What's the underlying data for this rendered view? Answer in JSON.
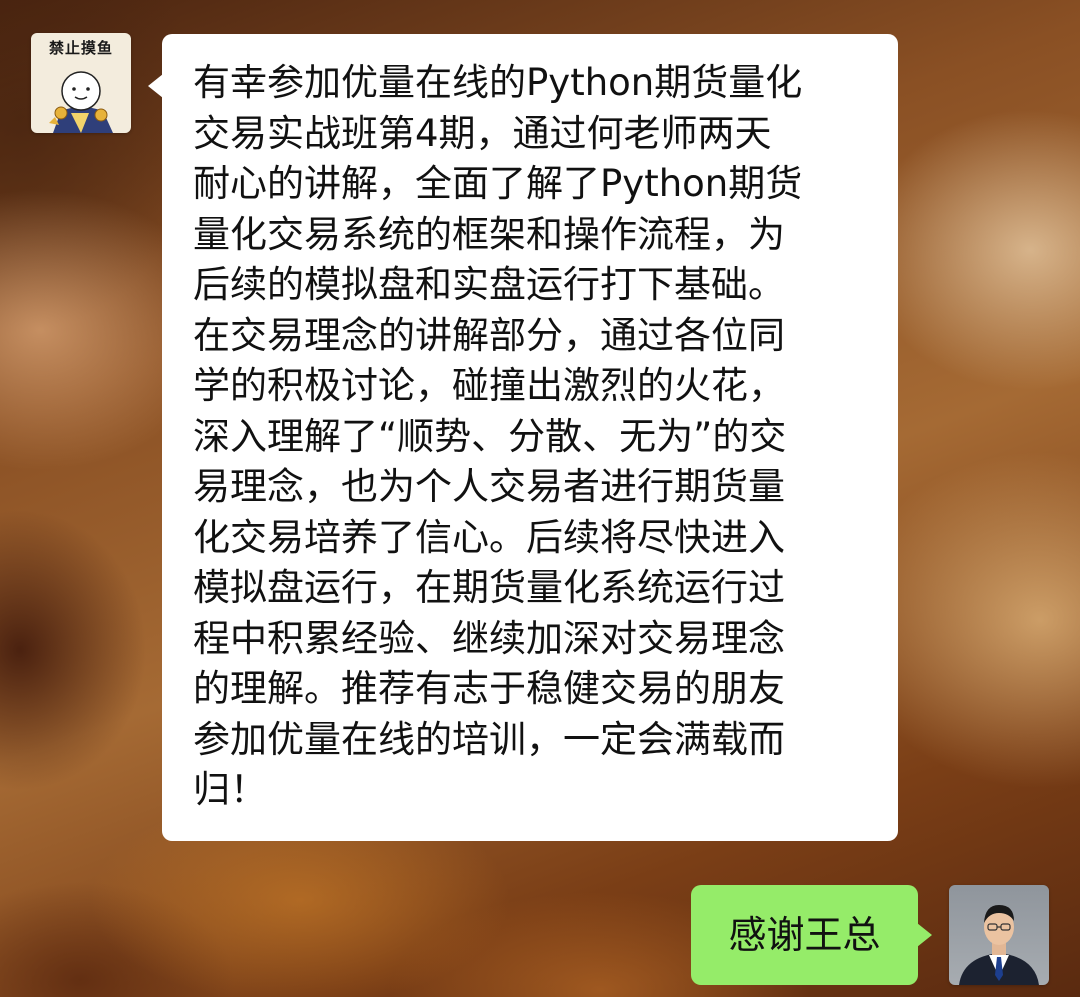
{
  "chat": {
    "messages": [
      {
        "sender": "contact",
        "avatar_caption": "禁止摸鱼",
        "text": "有幸参加优量在线的Python期货量化\n交易实战班第4期，通过何老师两天\n耐心的讲解，全面了解了Python期货\n量化交易系统的框架和操作流程，为\n后续的模拟盘和实盘运行打下基础。\n在交易理念的讲解部分，通过各位同\n学的积极讨论，碰撞出激烈的火花，\n深入理解了“顺势、分散、无为”的交\n易理念，也为个人交易者进行期货量\n化交易培养了信心。后续将尽快进入\n模拟盘运行，在期货量化系统运行过\n程中积累经验、继续加深对交易理念\n的理解。推荐有志于稳健交易的朋友\n参加优量在线的培训，一定会满载而\n归！"
      },
      {
        "sender": "self",
        "text": "感谢王总"
      }
    ]
  },
  "colors": {
    "incoming_bubble": "#ffffff",
    "outgoing_bubble": "#95ec69",
    "text": "#111111"
  },
  "icons": {
    "contact_avatar": "sticker-avatar-icon",
    "self_avatar": "person-avatar-icon"
  }
}
